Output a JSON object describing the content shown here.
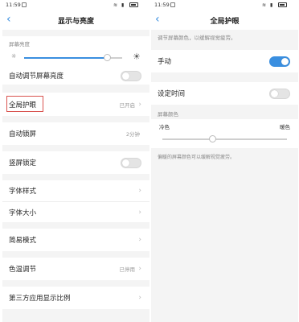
{
  "accent_color": "#3a8fe0",
  "highlight_color": "#d9534f",
  "left": {
    "status_time": "11:59",
    "title": "显示与亮度",
    "brightness_label": "屏幕亮度",
    "brightness_level": 0.85,
    "auto_brightness": "自动调节屏幕亮度",
    "eye_care": {
      "label": "全局护眼",
      "value": "已开启"
    },
    "auto_lock": {
      "label": "自动锁屏",
      "value": "2分钟"
    },
    "portrait_lock": "竖屏锁定",
    "font_style": "字体样式",
    "font_size": "字体大小",
    "simple_mode": "简易模式",
    "color_temp": {
      "label": "色温调节",
      "value": "已停用"
    },
    "third_party_ratio": "第三方应用显示比例"
  },
  "right": {
    "status_time": "11:59",
    "title": "全局护眼",
    "intro": "调节屏幕颜色，以缓解视觉疲劳。",
    "manual": {
      "label": "手动",
      "on": true
    },
    "schedule": {
      "label": "设定时间",
      "on": false
    },
    "screen_color_label": "屏幕颜色",
    "cool": "冷色",
    "warm": "暖色",
    "color_level": 0.4,
    "note": "偏暖的屏幕颜色可以缓解视觉疲劳。"
  }
}
